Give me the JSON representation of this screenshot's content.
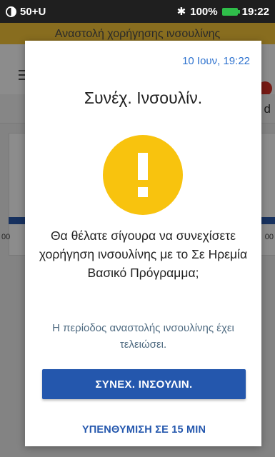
{
  "status_bar": {
    "carrier": "50+U",
    "battery_percent": "100%",
    "time": "19:22",
    "icons": [
      "notification-circle-icon",
      "bluetooth-icon",
      "battery-charging-icon"
    ],
    "battery_color": "#2fbf4a"
  },
  "background": {
    "banner_text": "Αναστολή χορήγησης ινσουλίνης",
    "tab_partial": "d",
    "tick_left": "00",
    "tick_right": "00",
    "banner_color": "#f7c739"
  },
  "dialog": {
    "timestamp": "10 Ιουν, 19:22",
    "title": "Συνέχ. Ινσουλίν.",
    "icon": "alert-exclamation-icon",
    "question": "Θα θέλατε σίγουρα να συνεχίσετε χορήγηση ινσουλίνης με το Σε Ηρεμία Βασικό Πρόγραμμα;",
    "info": "Η περίοδος αναστολής ινσουλίνης έχει τελειώσει.",
    "primary_button": "ΣΥΝΕΧ. ΙΝΣΟΥΛΙΝ.",
    "secondary_button": "ΥΠΕΝΘΥΜΙΣΗ ΣΕ 15 MIN",
    "accent_color": "#2457ad",
    "alert_color": "#f8c30e"
  }
}
